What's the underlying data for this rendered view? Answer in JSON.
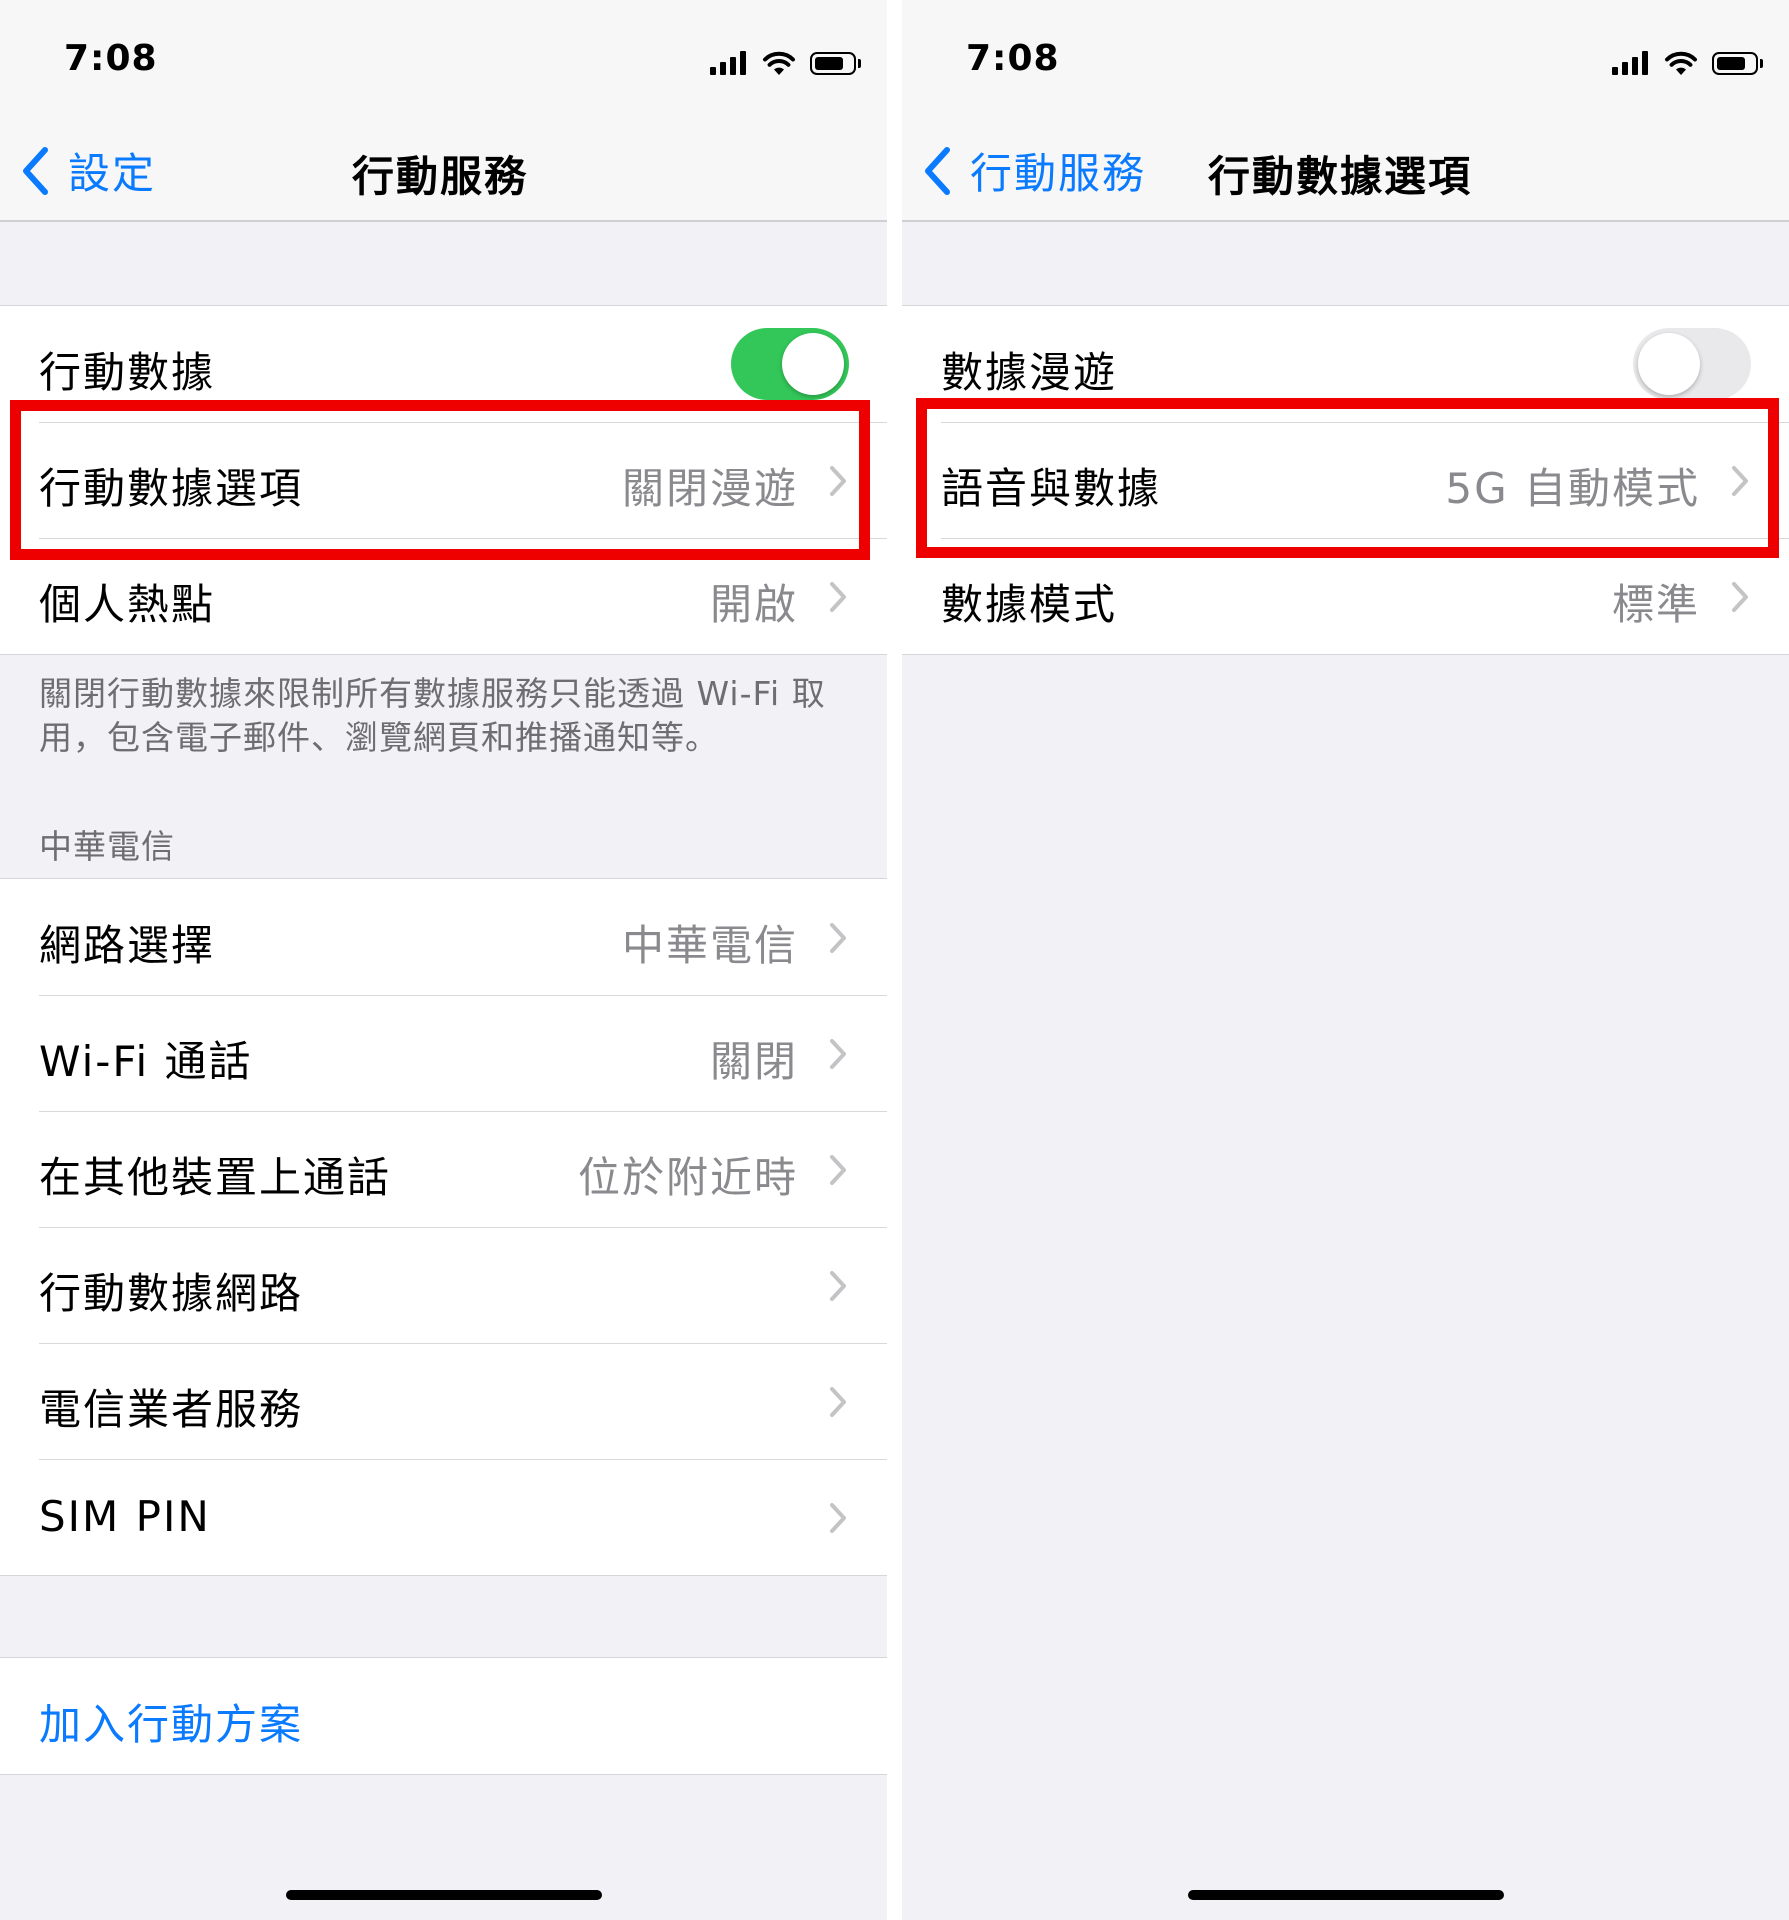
{
  "left_screen": {
    "status": {
      "time": "7:08"
    },
    "nav": {
      "back_label": "設定",
      "title": "行動服務"
    },
    "group1": {
      "cellular_data": {
        "label": "行動數據",
        "toggle_on": true
      },
      "cellular_options": {
        "label": "行動數據選項",
        "value": "關閉漫遊"
      },
      "hotspot": {
        "label": "個人熱點",
        "value": "開啟"
      }
    },
    "footer_text": "關閉行動數據來限制所有數據服務只能透過 Wi-Fi 取用，包含電子郵件、瀏覽網頁和推播通知等。",
    "carrier_section": {
      "header": "中華電信",
      "items": [
        {
          "label": "網路選擇",
          "value": "中華電信"
        },
        {
          "label": "Wi-Fi 通話",
          "value": "關閉"
        },
        {
          "label": "在其他裝置上通話",
          "value": "位於附近時"
        },
        {
          "label": "行動數據網路",
          "value": ""
        },
        {
          "label": "電信業者服務",
          "value": ""
        },
        {
          "label": "SIM PIN",
          "value": ""
        }
      ]
    },
    "add_plan": {
      "label": "加入行動方案"
    }
  },
  "right_screen": {
    "status": {
      "time": "7:08"
    },
    "nav": {
      "back_label": "行動服務",
      "title": "行動數據選項"
    },
    "group1": {
      "data_roaming": {
        "label": "數據漫遊",
        "toggle_on": false
      },
      "voice_data": {
        "label": "語音與數據",
        "value": "5G 自動模式"
      },
      "data_mode": {
        "label": "數據模式",
        "value": "標準"
      }
    }
  },
  "colors": {
    "accent": "#0a7aff",
    "toggle_on": "#33c759",
    "highlight": "#ee0000",
    "background": "#f2f1f6"
  }
}
